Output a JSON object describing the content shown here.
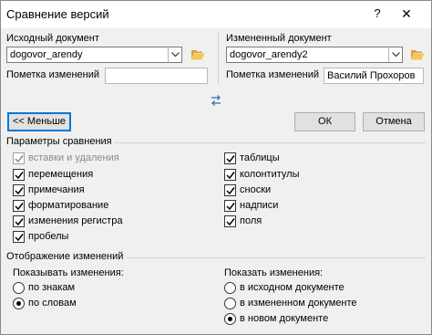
{
  "window": {
    "title": "Сравнение версий",
    "help": "?",
    "close": "✕"
  },
  "original": {
    "label": "Исходный документ",
    "file": "dogovor_arendy",
    "changes_label": "Пометка изменений",
    "changes_value": ""
  },
  "revised": {
    "label": "Измененный документ",
    "file": "dogovor_arendy2",
    "changes_label": "Пометка изменений",
    "changes_value": "Василий Прохоров"
  },
  "buttons": {
    "less": "<< Меньше",
    "ok": "ОК",
    "cancel": "Отмена"
  },
  "comparison": {
    "heading": "Параметры сравнения",
    "left": [
      {
        "label": "вставки и удаления",
        "checked": true,
        "disabled": true
      },
      {
        "label": "перемещения",
        "checked": true
      },
      {
        "label": "примечания",
        "checked": true
      },
      {
        "label": "форматирование",
        "checked": true
      },
      {
        "label": "изменения регистра",
        "checked": true
      },
      {
        "label": "пробелы",
        "checked": true
      }
    ],
    "right": [
      {
        "label": "таблицы",
        "checked": true
      },
      {
        "label": "колонтитулы",
        "checked": true
      },
      {
        "label": "сноски",
        "checked": true
      },
      {
        "label": "надписи",
        "checked": true
      },
      {
        "label": "поля",
        "checked": true
      }
    ]
  },
  "display": {
    "heading": "Отображение изменений",
    "level": {
      "label": "Показывать изменения:",
      "options": [
        {
          "label": "по знакам",
          "selected": false
        },
        {
          "label": "по словам",
          "selected": true
        }
      ]
    },
    "location": {
      "label": "Показать изменения:",
      "options": [
        {
          "label": "в исходном документе",
          "selected": false
        },
        {
          "label": "в измененном документе",
          "selected": false
        },
        {
          "label": "в новом документе",
          "selected": true
        }
      ]
    }
  },
  "icons": {
    "folder": "folder-open-icon",
    "swap": "swap-arrows-icon",
    "dropdown": "chevron-down-icon",
    "check": "checkmark-icon"
  },
  "colors": {
    "accent": "#0078d7",
    "folder": "#e8b94a"
  }
}
